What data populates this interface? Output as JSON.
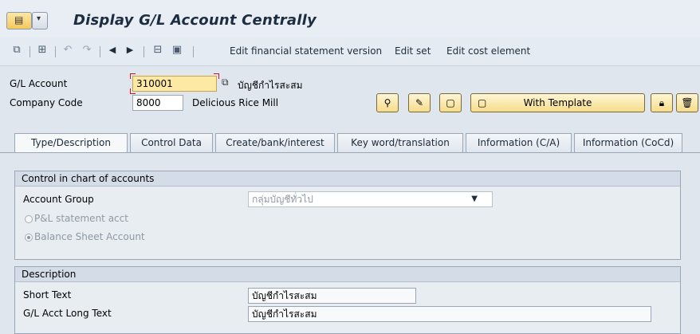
{
  "header": {
    "title": "Display G/L Account Centrally"
  },
  "toolbar": {
    "links": [
      "Edit financial statement version",
      "Edit set",
      "Edit cost element"
    ]
  },
  "fields": {
    "gl_account_label": "G/L Account",
    "gl_account_value": "310001",
    "gl_account_desc": "บัญชีกำไรสะสม",
    "company_code_label": "Company Code",
    "company_code_value": "8000",
    "company_name": "Delicious Rice Mill"
  },
  "buttons": {
    "with_template": "With Template"
  },
  "tabs": [
    "Type/Description",
    "Control Data",
    "Create/bank/interest",
    "Key word/translation",
    "Information (C/A)",
    "Information (CoCd)"
  ],
  "control_group": {
    "title": "Control in chart of accounts",
    "account_group_label": "Account Group",
    "account_group_value": "กลุ่มบัญชีทั่วไป",
    "pl_label": "P&L statement acct",
    "bs_label": "Balance Sheet Account"
  },
  "description_group": {
    "title": "Description",
    "short_text_label": "Short Text",
    "short_text_value": "บัญชีกำไรสะสม",
    "long_text_label": "G/L Acct Long Text",
    "long_text_value": "บัญชีกำไรสะสม"
  },
  "colors": {
    "background": "#dfe6ee",
    "required_field": "#fde9a4",
    "accent_title": "#1d2d41"
  },
  "icons": [
    "menu-icon",
    "dropdown-icon",
    "other-account-icon",
    "hierarchy-icon",
    "back-icon",
    "forward-icon",
    "previous-icon",
    "next-icon",
    "where-used-icon",
    "document-icon",
    "display-change-icon",
    "edit-icon",
    "create-icon",
    "lock-icon",
    "delete-icon"
  ]
}
